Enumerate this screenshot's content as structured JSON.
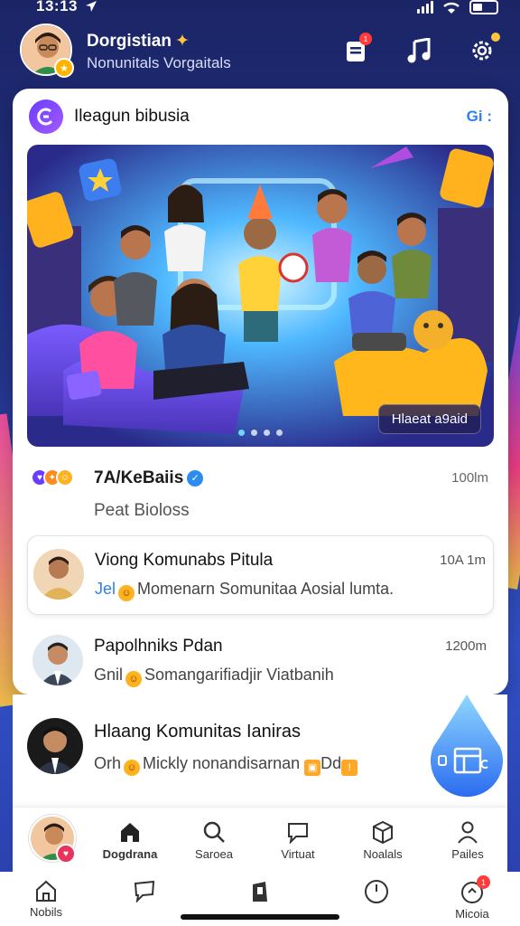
{
  "status_bar": {
    "time": "13:13"
  },
  "header": {
    "name": "Dorgistian",
    "subtitle": "Nonunitals Vorgaitals",
    "notification_badge": "1"
  },
  "card": {
    "title": "Ileagun bibusia",
    "more_label": "Gi :",
    "banner_tag": "Hlaeat a9aid",
    "post": {
      "title": "7A/KeBaiis",
      "time": "100lm",
      "subtitle": "Peat Bioloss"
    },
    "messages": [
      {
        "name": "Viong Komunabs Pitula",
        "prefix": "Jel",
        "text": "Momenarn Somunitaa Aosial lumta.",
        "time": "10A 1m"
      },
      {
        "name": "Papolhniks Pdan",
        "prefix": "Gnil",
        "text": "Somangarifiadjir Viatbanih",
        "time": "1200m"
      }
    ]
  },
  "outer_message": {
    "name": "Hlaang Komunitas Ianiras",
    "prefix": "Orh",
    "text": "Mickly nonandisarnan",
    "suffix": "Dd"
  },
  "tabbar": [
    {
      "label": "Dogdrana",
      "icon": "home-filled-icon"
    },
    {
      "label": "Saroea",
      "icon": "search-icon"
    },
    {
      "label": "Virtuat",
      "icon": "chat-bubble-icon"
    },
    {
      "label": "Noalals",
      "icon": "box-icon"
    },
    {
      "label": "Pailes",
      "icon": "person-icon"
    }
  ],
  "system_bar": [
    {
      "label": "Nobils",
      "icon": "home-outline-icon"
    },
    {
      "label": "",
      "icon": "message-icon"
    },
    {
      "label": "",
      "icon": "clipboard-icon"
    },
    {
      "label": "",
      "icon": "clock-icon"
    },
    {
      "label": "Micoia",
      "icon": "bell-icon",
      "badge": "1"
    }
  ]
}
